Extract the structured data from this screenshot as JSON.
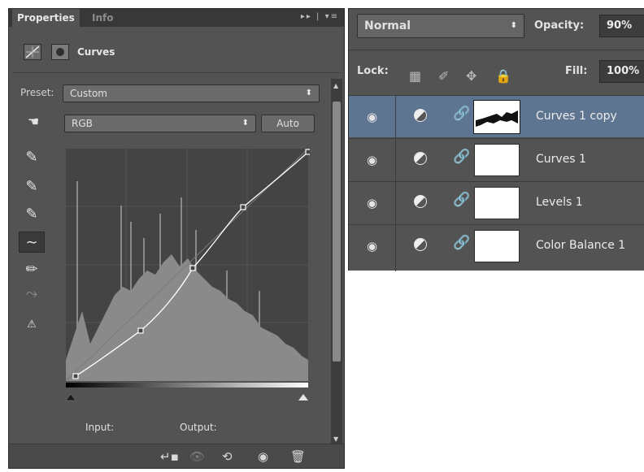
{
  "properties": {
    "tabs": [
      "Properties",
      "Info"
    ],
    "title": "Curves",
    "preset_label": "Preset:",
    "preset_value": "Custom",
    "channel_value": "RGB",
    "auto_button": "Auto",
    "input_label": "Input:",
    "output_label": "Output:"
  },
  "layers": {
    "blend_mode": "Normal",
    "opacity_label": "Opacity:",
    "opacity_value": "90%",
    "lock_label": "Lock:",
    "fill_label": "Fill:",
    "fill_value": "100%",
    "items": [
      {
        "name": "Curves 1 copy",
        "selected": true
      },
      {
        "name": "Curves 1",
        "selected": false
      },
      {
        "name": "Levels 1",
        "selected": false
      },
      {
        "name": "Color Balance 1",
        "selected": false
      }
    ]
  },
  "colors": {
    "panel": "#535353",
    "selection": "#5e7592"
  }
}
